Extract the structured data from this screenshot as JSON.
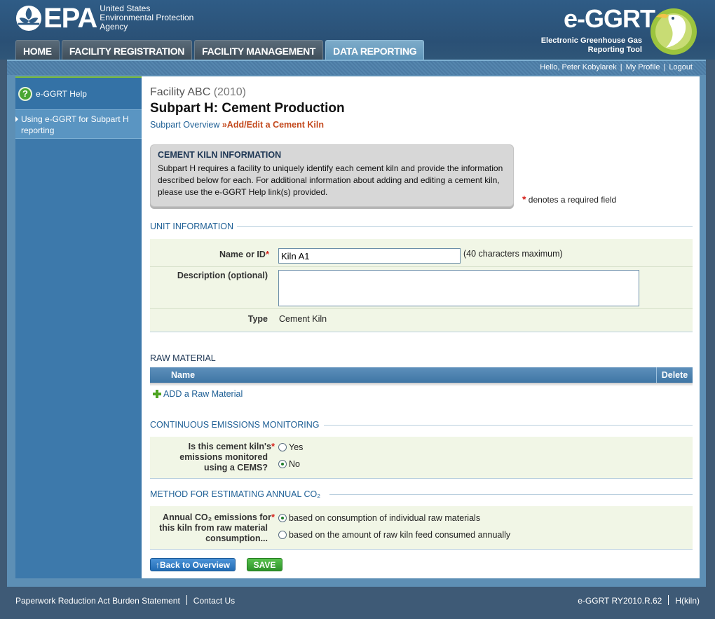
{
  "header": {
    "epa_word": "EPA",
    "agency_line1": "United States",
    "agency_line2": "Environmental Protection",
    "agency_line3": "Agency",
    "eggrt_logo": "e-GGRT",
    "eggrt_tag_line1": "Electronic Greenhouse Gas",
    "eggrt_tag_line2": "Reporting Tool"
  },
  "nav": {
    "tabs": [
      {
        "label": "HOME"
      },
      {
        "label": "FACILITY REGISTRATION"
      },
      {
        "label": "FACILITY MANAGEMENT"
      },
      {
        "label": "DATA REPORTING"
      }
    ],
    "active_index": 3
  },
  "userbar": {
    "greeting": "Hello, Peter Kobylarek",
    "my_profile": "My Profile",
    "logout": "Logout"
  },
  "sidebar": {
    "help_label": "e-GGRT Help",
    "sub_item": "Using e-GGRT for Subpart H reporting"
  },
  "page": {
    "facility_name": "Facility ABC",
    "facility_year": "(2010)",
    "subpart_title": "Subpart H: Cement Production",
    "breadcrumb_link": "Subpart Overview",
    "breadcrumb_arrow": "»",
    "breadcrumb_current": "Add/Edit a Cement Kiln"
  },
  "info_box": {
    "title": "CEMENT KILN INFORMATION",
    "text": "Subpart H requires a facility to uniquely identify each cement kiln and provide the information described below for each. For additional information about adding and editing a cement kiln, please use the e-GGRT Help link(s) provided."
  },
  "required_note": {
    "star": "*",
    "text": "denotes a required field"
  },
  "unit_info": {
    "heading": "UNIT INFORMATION",
    "name_label": "Name or ID",
    "name_value": "Kiln A1",
    "name_hint": "(40 characters maximum)",
    "desc_label": "Description (optional)",
    "desc_value": "",
    "type_label": "Type",
    "type_value": "Cement Kiln"
  },
  "raw_material": {
    "heading": "RAW MATERIAL",
    "col_name": "Name",
    "col_delete": "Delete",
    "add_label": "ADD a Raw Material"
  },
  "cems": {
    "heading": "CONTINUOUS EMISSIONS MONITORING",
    "question_line1": "Is this cement kiln's",
    "question_line2": "emissions monitored",
    "question_line3": "using a CEMS?",
    "option_yes": "Yes",
    "option_no": "No",
    "selected": "No"
  },
  "method": {
    "heading": "METHOD FOR ESTIMATING ANNUAL CO₂",
    "question_line1": "Annual CO₂ emissions for",
    "question_line2": "this kiln from raw material",
    "question_line3": "consumption...",
    "option_1": "based on consumption of individual raw materials",
    "option_2": "based on the amount of raw kiln feed consumed annually",
    "selected": "option_1"
  },
  "buttons": {
    "back": "Back to Overview",
    "save": "SAVE"
  },
  "footer": {
    "paperwork": "Paperwork Reduction Act Burden Statement",
    "contact": "Contact Us",
    "version": "e-GGRT RY2010.R.62",
    "page_id": "H(kiln)"
  },
  "colors": {
    "accent_blue": "#1e5f95",
    "current_crumb": "#c3491d",
    "required_star": "#d6241e",
    "save_green": "#2d9229"
  }
}
